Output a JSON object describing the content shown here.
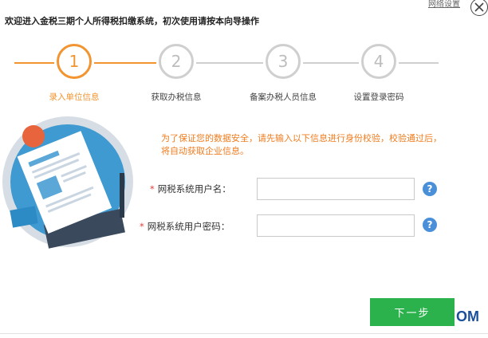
{
  "header": {
    "title": "欢迎进入金税三期个人所得税扣缴系统，初次使用请按本向导操作"
  },
  "top_link": {
    "network_settings": "网络设置"
  },
  "steps": [
    {
      "number": "1",
      "label": "录入单位信息",
      "state": "active"
    },
    {
      "number": "2",
      "label": "获取办税信息",
      "state": "inactive"
    },
    {
      "number": "3",
      "label": "备案办税人员信息",
      "state": "inactive"
    },
    {
      "number": "4",
      "label": "设置登录密码",
      "state": "inactive"
    }
  ],
  "notice": "为了保证您的数据安全，请先输入以下信息进行身份校验，校验通过后，将自动获取企业信息。",
  "form": {
    "required_mark": "*",
    "username_label": "网税系统用户名：",
    "username_value": "",
    "password_label": "网税系统用户密码：",
    "password_value": "",
    "help_glyph": "?"
  },
  "next_button": "下一步",
  "watermark": "OM",
  "colors": {
    "accent": "#f29430",
    "inactive": "#cfcfcf",
    "button": "#2bb24c",
    "help": "#4a90d9"
  }
}
